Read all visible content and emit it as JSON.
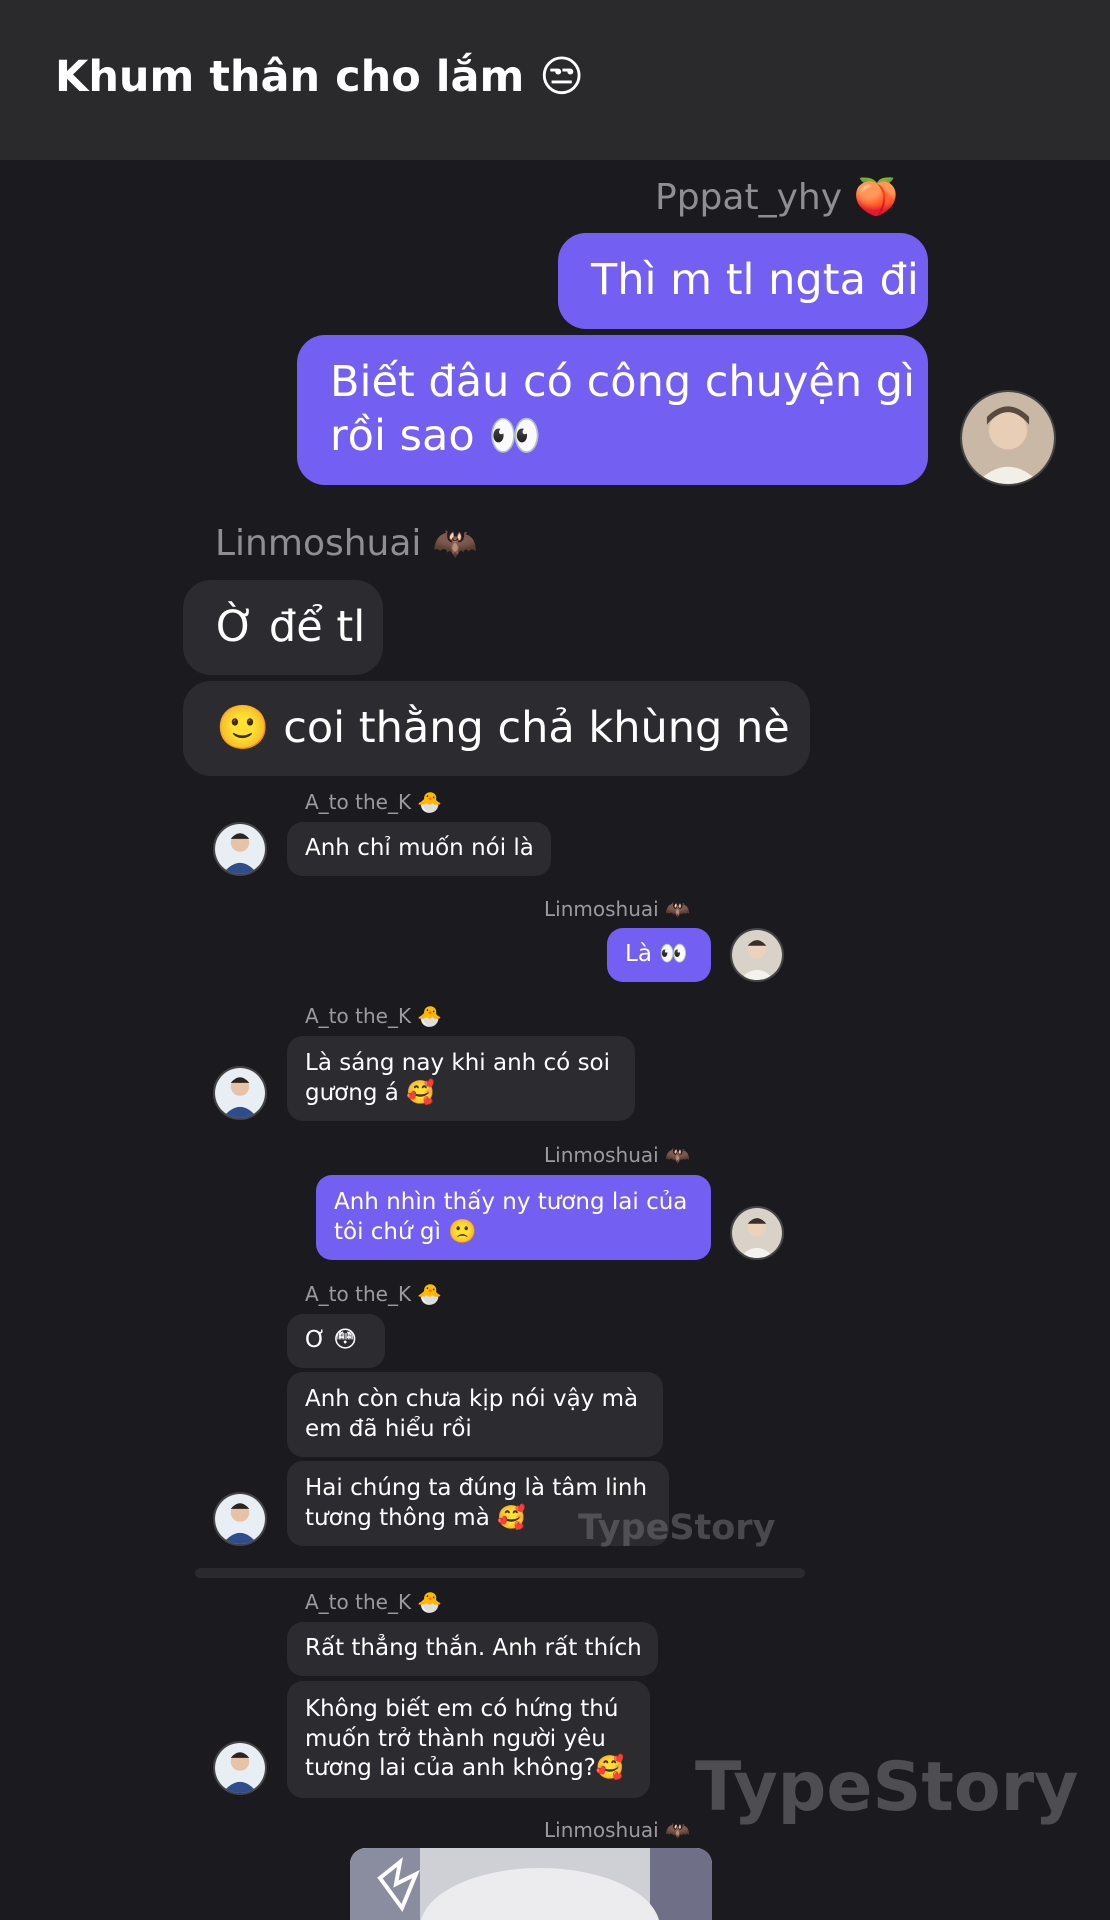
{
  "header": {
    "title": "Khum thân cho lắm 😒"
  },
  "messages": {
    "m1": {
      "sender": "Pppat_yhy 🍑",
      "line1": "Thì m tl ngta đi",
      "line2a": "Biết đâu có công chuyện gì",
      "line2b": "rồi sao 👀"
    },
    "m2": {
      "sender": "Linmoshuai 🦇",
      "b1": "Ờ để tl",
      "b2": "🙂 coi thằng chả khùng nè"
    },
    "m3": {
      "sender": "A_to the_K 🐣",
      "b1": "Anh chỉ muốn nói là"
    },
    "m4": {
      "sender": "Linmoshuai 🦇",
      "b1": "Là 👀"
    },
    "m5": {
      "sender": "A_to the_K 🐣",
      "b1a": "Là sáng nay khi anh có soi",
      "b1b": "gương á 🥰"
    },
    "m6": {
      "sender": "Linmoshuai 🦇",
      "b1a": "Anh nhìn thấy ny tương lai của",
      "b1b": "tôi chứ gì 🙁"
    },
    "m7": {
      "sender": "A_to the_K 🐣",
      "b1": "Ơ 😳",
      "b2a": "Anh còn chưa kịp nói vậy mà",
      "b2b": "em đã hiểu rồi",
      "b3a": "Hai chúng ta đúng là tâm linh",
      "b3b": "tương thông mà 🥰"
    },
    "m8": {
      "sender": "A_to the_K 🐣",
      "b1": "Rất thẳng thắn. Anh rất thích",
      "b2a": "Không biết em có hứng thú",
      "b2b": "muốn trở thành người yêu",
      "b2c": "tương lai của anh không?🥰"
    },
    "m9": {
      "sender": "Linmoshuai 🦇"
    }
  },
  "watermark": {
    "text": "TypeStory"
  },
  "colors": {
    "accent": "#7360f2",
    "background": "#1b1b1f",
    "incoming_bubble": "#2c2c30",
    "header": "#2a2a2d"
  },
  "icons": [
    "peach-emoji",
    "bat-emoji",
    "chick-emoji",
    "eyes-emoji",
    "avatar"
  ]
}
